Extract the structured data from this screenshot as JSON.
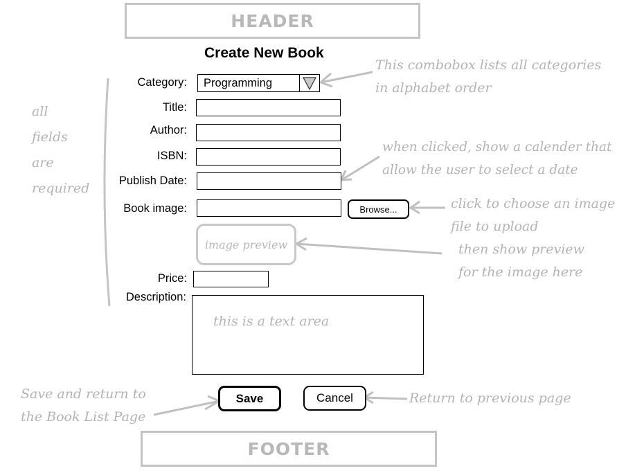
{
  "header": {
    "label": "HEADER"
  },
  "form": {
    "title": "Create New Book",
    "category": {
      "label": "Category:",
      "value": "Programming"
    },
    "title_field": {
      "label": "Title:",
      "value": ""
    },
    "author": {
      "label": "Author:",
      "value": ""
    },
    "isbn": {
      "label": "ISBN:",
      "value": ""
    },
    "publish_date": {
      "label": "Publish Date:",
      "value": ""
    },
    "book_image": {
      "label": "Book image:",
      "value": "",
      "browse_label": "Browse..."
    },
    "image_preview": {
      "text": "image preview"
    },
    "price": {
      "label": "Price:",
      "value": ""
    },
    "description": {
      "label": "Description:",
      "placeholder": "this is a text area"
    },
    "save_label": "Save",
    "cancel_label": "Cancel"
  },
  "notes": {
    "required": [
      "all",
      "fields",
      "are",
      "required"
    ],
    "combobox": [
      "This combobox lists all categories",
      "in alphabet order"
    ],
    "calendar": [
      "when clicked, show a calender that",
      "allow the user to select a date"
    ],
    "browse": [
      "click to choose an image",
      "file to upload"
    ],
    "preview": [
      "then show preview",
      "for the image here"
    ],
    "save": [
      "Save and return to",
      "the Book List Page"
    ],
    "cancel": "Return to previous page"
  },
  "footer": {
    "label": "FOOTER"
  },
  "colors": {
    "annotation": "#b4b4b4",
    "frame": "#c4c4c4",
    "ink": "#000000"
  }
}
